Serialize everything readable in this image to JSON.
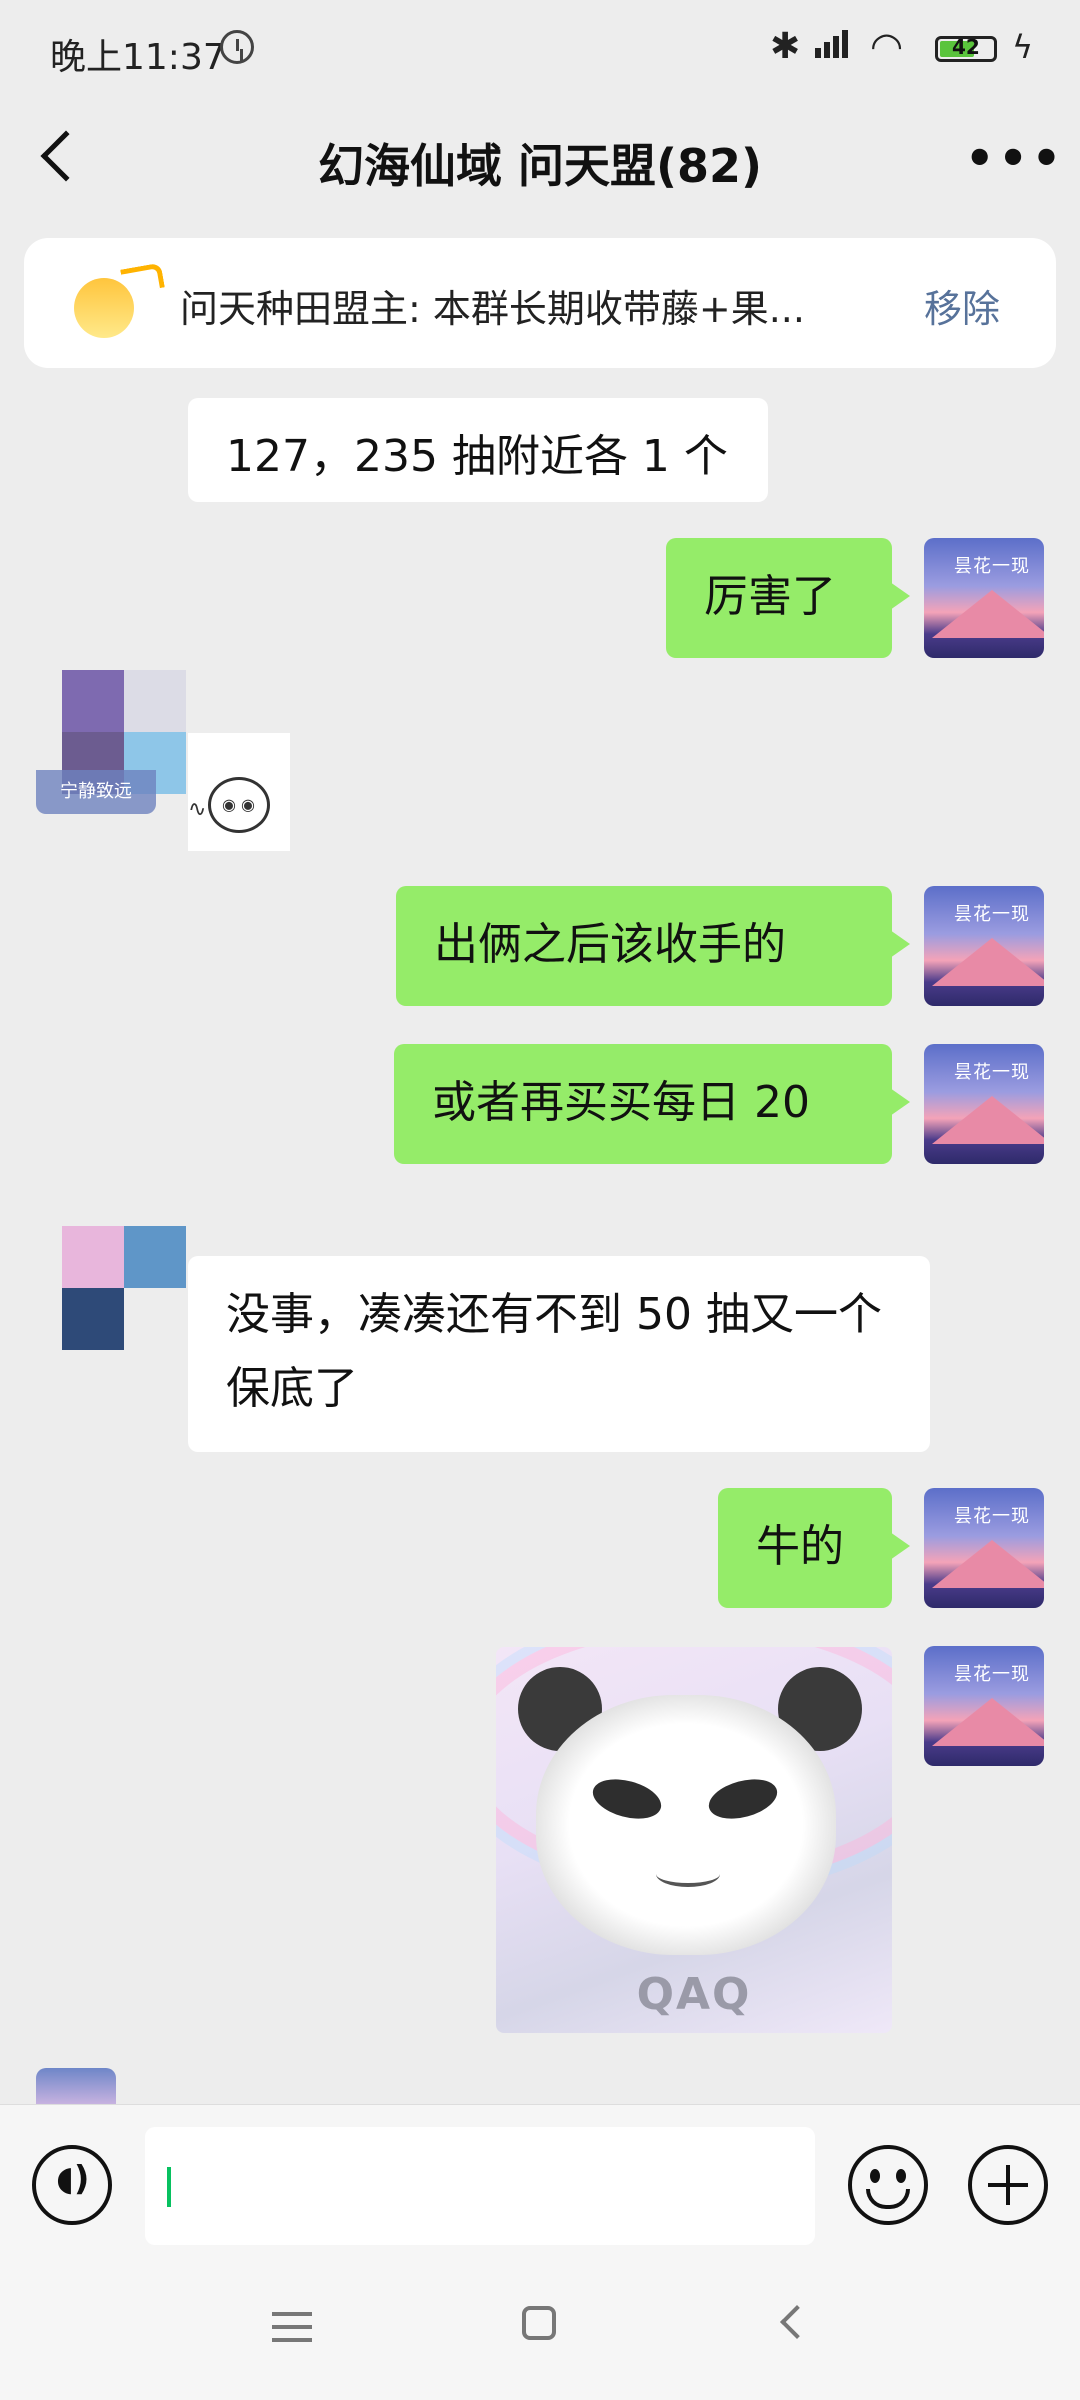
{
  "status_bar": {
    "time": "晚上11:37",
    "battery": "42",
    "network": "HD"
  },
  "header": {
    "title": "幻海仙域 问天盟(82)",
    "back_icon": "back-chevron-icon",
    "more_icon": "more-dots-icon"
  },
  "notice": {
    "text": "问天种田盟主: 本群长期收带藤+果...",
    "action": "移除"
  },
  "messages": [
    {
      "from": "other",
      "text": "127，235 抽附近各 1 个"
    },
    {
      "from": "me",
      "text": "厉害了"
    },
    {
      "from": "other",
      "sticker": true,
      "name_label": "宁静致远"
    },
    {
      "from": "me",
      "text": "出俩之后该收手的"
    },
    {
      "from": "me",
      "text": "或者再买买每日 20"
    },
    {
      "from": "other",
      "text": "没事，凑凑还有不到 50 抽又一个保底了"
    },
    {
      "from": "me",
      "text": "牛的"
    },
    {
      "from": "me",
      "sticker": true,
      "sticker_text": "QAQ"
    }
  ],
  "my_avatar": {
    "caption": "昙花一现"
  },
  "input": {
    "value": ""
  },
  "colors": {
    "background": "#ededed",
    "my_bubble": "#95ec69",
    "other_bubble": "#ffffff",
    "link": "#57729a"
  }
}
